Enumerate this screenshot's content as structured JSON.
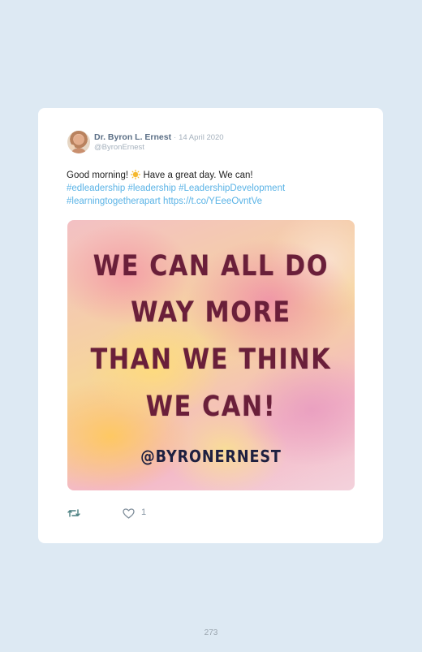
{
  "tweet": {
    "author_name": "Dr. Byron L. Ernest",
    "separator": "·",
    "date": "14 April 2020",
    "handle": "@ByronErnest",
    "text_before_emoji": "Good morning!",
    "emoji_icon": "sun-icon",
    "text_after_emoji": "Have a great day. We can!",
    "hashtags_line1": "#edleadership #leadership #LeadershipDevelopment",
    "hashtag_line2": "#learningtogetherapart",
    "link": "https://t.co/YEeeOvntVe"
  },
  "media": {
    "quote_lines": [
      "WE CAN ALL DO",
      "WAY MORE",
      "THAN WE THINK",
      "WE CAN!"
    ],
    "handle_text": "@BYRONERNEST"
  },
  "actions": {
    "retweet_icon": "retweet-icon",
    "like_icon": "heart-icon",
    "like_count": "1"
  },
  "page": {
    "number": "273"
  },
  "colors": {
    "background": "#dde9f3",
    "link": "#5ab3e6",
    "quote_text": "#6a1f3a",
    "handle_text": "#1e2040"
  }
}
